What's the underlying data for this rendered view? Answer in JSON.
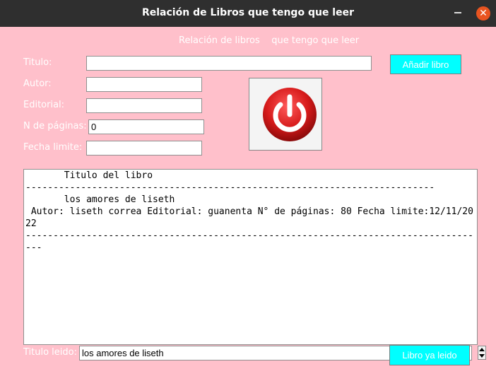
{
  "window": {
    "title": "Relación de Libros que tengo que leer"
  },
  "heading": "Relación de libros    que tengo que leer",
  "form": {
    "titulo_label": "Titulo:",
    "titulo_value": "",
    "autor_label": "Autor:",
    "autor_value": "",
    "editorial_label": "Editorial:",
    "editorial_value": "",
    "paginas_label": "N de páginas:",
    "paginas_value": "0",
    "fecha_label": "Fecha limite:",
    "fecha_value": "",
    "add_button": "Añadir libro"
  },
  "power_button": {
    "icon": "power-icon",
    "color": "#e01e1e"
  },
  "list": {
    "lines": [
      "       Titulo del libro",
      "--------------------------------------------------------------------------",
      "       los amores de liseth",
      " Autor: liseth correa Editorial: guanenta N° de páginas: 80 Fecha limite:12/11/2022",
      "------------------------------------------------------------------------------------"
    ]
  },
  "footer": {
    "leido_label": "Titulo leido:",
    "leido_value": "los amores de liseth",
    "leido_button": "Libro ya leido"
  },
  "colors": {
    "background": "#ffc0cb",
    "button": "#00ffff",
    "titlebar": "#2f2f2f",
    "close": "#e95420"
  }
}
